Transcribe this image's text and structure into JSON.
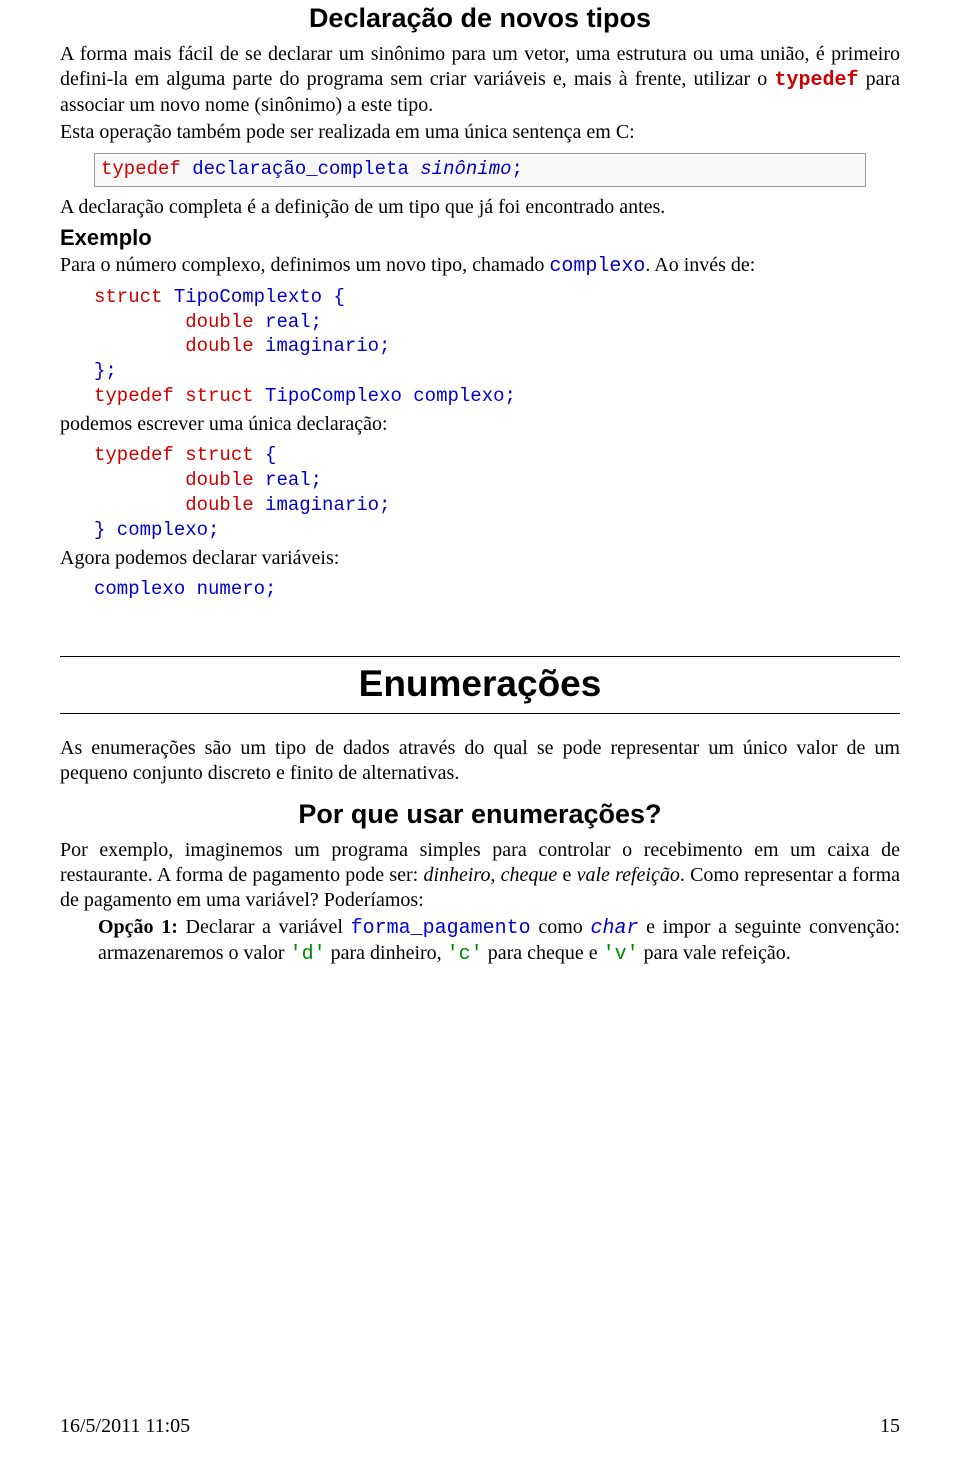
{
  "s1": {
    "title": "Declaração de novos tipos",
    "p1a": "A forma mais fácil de se declarar um sinônimo para um vetor, uma estrutura ou uma união, é primeiro defini-la em alguma parte do programa sem criar variáveis e, mais à frente, utilizar o ",
    "p1b": "typedef",
    "p1c": " para associar um novo nome (sinônimo) a este tipo.",
    "p2": "Esta operação também pode ser realizada em uma única sentença em C:",
    "code1a": "typedef",
    "code1b": " declaração_completa ",
    "code1c": "sinônimo",
    "code1d": ";",
    "p3": "A declaração completa é a definição de um tipo que já foi encontrado antes.",
    "h3": "Exemplo",
    "p4a": "Para o número complexo, definimos um novo tipo, chamado ",
    "p4b": "complexo",
    "p4c": ". Ao invés de:",
    "code2_l1a": "struct",
    "code2_l1b": " TipoComplexto {",
    "code2_l2a": "        double",
    "code2_l2b": " real;",
    "code2_l3a": "        double",
    "code2_l3b": " imaginario;",
    "code2_l4": "};",
    "code2_l5a": "typedef",
    "code2_l5b": " struct",
    "code2_l5c": " TipoComplexo complexo;",
    "p5": "podemos escrever uma única declaração:",
    "code3_l1a": "typedef",
    "code3_l1b": " struct",
    "code3_l1c": " {",
    "code3_l2a": "        double",
    "code3_l2b": " real;",
    "code3_l3a": "        double",
    "code3_l3b": " imaginario;",
    "code3_l4": "} complexo;",
    "p6": "Agora podemos declarar variáveis:",
    "code4": "complexo numero;"
  },
  "s2": {
    "title": "Enumerações",
    "p1": "As enumerações são um tipo de dados através do qual se pode representar um único valor de um pequeno conjunto discreto e finito de alternativas.",
    "h2": "Por que usar enumerações?",
    "p2a": "Por exemplo, imaginemos um programa simples para controlar o recebimento em um caixa de restaurante. A forma de pagamento pode ser: ",
    "p2b": "dinheiro",
    "p2c": ", ",
    "p2d": "cheque",
    "p2e": " e ",
    "p2f": "vale refeição",
    "p2g": ". Como representar a forma de pagamento em uma variável? Poderíamos:",
    "opt1a": "Opção 1:",
    "opt1b": " Declarar a variável ",
    "opt1c": "forma_pagamento",
    "opt1d": " como ",
    "opt1e": "char",
    "opt1f": " e impor a seguinte convenção: armazenaremos o valor ",
    "opt1g": "'d'",
    "opt1h": " para dinheiro, ",
    "opt1i": "'c'",
    "opt1j": " para cheque e ",
    "opt1k": "'v'",
    "opt1l": " para vale refeição."
  },
  "footer": {
    "date": "16/5/2011 11:05",
    "page": "15"
  }
}
